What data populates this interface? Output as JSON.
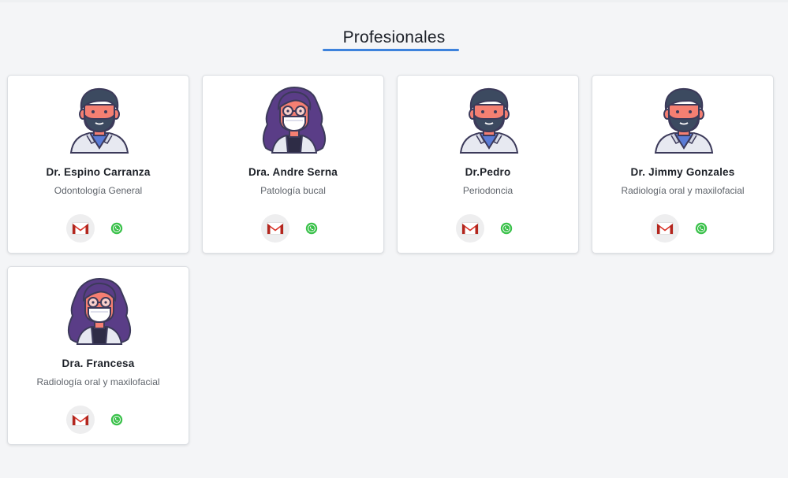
{
  "section": {
    "title": "Profesionales"
  },
  "colors": {
    "accent": "#3d82dc",
    "gmail_red": "#d93025",
    "whatsapp_green": "#3ac14a"
  },
  "professionals": [
    {
      "name": "Dr. Espino Carranza",
      "specialty": "Odontología General",
      "avatar": "male-doctor-icon"
    },
    {
      "name": "Dra. Andre Serna",
      "specialty": "Patología bucal",
      "avatar": "female-doctor-icon"
    },
    {
      "name": "Dr.Pedro",
      "specialty": "Periodoncia",
      "avatar": "male-doctor-icon"
    },
    {
      "name": "Dr. Jimmy Gonzales",
      "specialty": "Radiología oral y maxilofacial",
      "avatar": "male-doctor-icon"
    },
    {
      "name": "Dra. Francesa",
      "specialty": "Radiología oral y maxilofacial",
      "avatar": "female-doctor-icon"
    }
  ]
}
